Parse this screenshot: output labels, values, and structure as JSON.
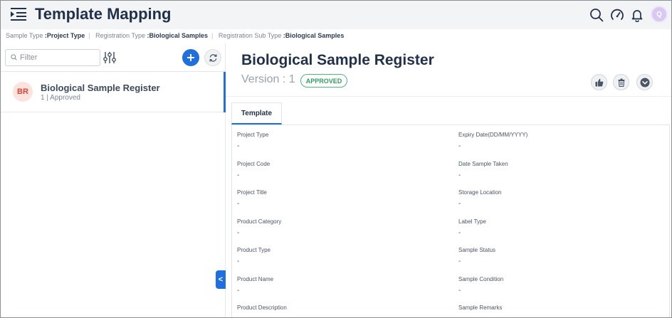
{
  "header": {
    "title": "Template Mapping",
    "avatar_initial": "Q",
    "icons": [
      "menu-icon",
      "search-icon",
      "speedometer-icon",
      "bell-icon"
    ]
  },
  "breadcrumb": [
    {
      "label": "Sample Type",
      "value": ":Project Type"
    },
    {
      "label": "Registration Type",
      "value": ":Biological Samples"
    },
    {
      "label": "Registration Sub Type",
      "value": ":Biological Samples"
    }
  ],
  "filter": {
    "placeholder": "Filter",
    "value": ""
  },
  "list": [
    {
      "initials": "BR",
      "title": "Biological Sample Register",
      "subtitle": "1 | Approved"
    }
  ],
  "collapse_label": "<",
  "detail": {
    "title": "Biological Sample Register",
    "version": "Version : 1",
    "status": "APPROVED",
    "tab": "Template"
  },
  "fields_left": [
    {
      "label": "Project Type",
      "value": "-"
    },
    {
      "label": "Project Code",
      "value": "-"
    },
    {
      "label": "Project Title",
      "value": "-"
    },
    {
      "label": "Product Category",
      "value": "-"
    },
    {
      "label": "Product Type",
      "value": "-"
    },
    {
      "label": "Product Name",
      "value": "-"
    },
    {
      "label": "Product Description",
      "value": ""
    }
  ],
  "fields_right": [
    {
      "label": "Expiry Date(DD/MM/YYYY)",
      "value": "-"
    },
    {
      "label": "Date Sample Taken",
      "value": "-"
    },
    {
      "label": "Storage Location",
      "value": "-"
    },
    {
      "label": "Label Type",
      "value": "-"
    },
    {
      "label": "Sample Status",
      "value": "-"
    },
    {
      "label": "Sample Condition",
      "value": "-"
    },
    {
      "label": "Sample Remarks",
      "value": ""
    }
  ],
  "colors": {
    "accent": "#1f6fde",
    "approved": "#2f9e5f",
    "badge": "#d9443a"
  }
}
